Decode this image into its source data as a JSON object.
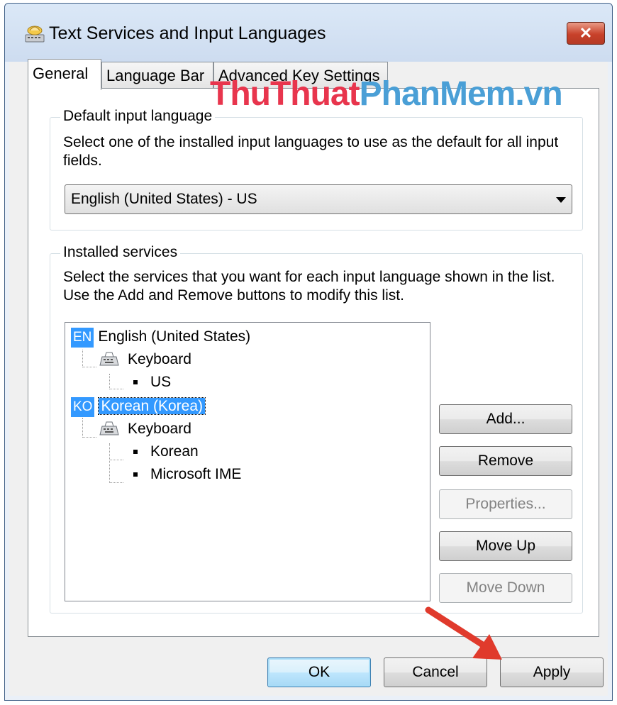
{
  "window": {
    "title": "Text Services and Input Languages",
    "close_glyph": "✕"
  },
  "tabs": [
    {
      "label": "General"
    },
    {
      "label": "Language Bar"
    },
    {
      "label": "Advanced Key Settings"
    }
  ],
  "watermark": {
    "part1": "ThuThuat",
    "part2": "PhanMem.vn"
  },
  "default_group": {
    "title": "Default input language",
    "description": "Select one of the installed input languages to use as the default for all input fields.",
    "selected_language": "English (United States) - US"
  },
  "services_group": {
    "title": "Installed services",
    "description_line1": "Select the services that you want for each input language shown in the list.",
    "description_line2": "Use the Add and Remove buttons to modify this list.",
    "tree": {
      "en": {
        "badge": "EN",
        "label": "English (United States)",
        "keyboard": "Keyboard",
        "layouts": [
          "US"
        ]
      },
      "ko": {
        "badge": "KO",
        "label": "Korean (Korea)",
        "keyboard": "Keyboard",
        "layouts": [
          "Korean",
          "Microsoft IME"
        ]
      }
    },
    "buttons": {
      "add": "Add...",
      "remove": "Remove",
      "properties": "Properties...",
      "move_up": "Move Up",
      "move_down": "Move Down"
    }
  },
  "footer": {
    "ok": "OK",
    "cancel": "Cancel",
    "apply": "Apply"
  },
  "colors": {
    "watermark_red": "#e8354d",
    "watermark_blue": "#4a9fd6",
    "selection": "#3399ff",
    "arrow": "#e03a2c"
  },
  "icons": [
    "text-services-icon",
    "close-icon",
    "dropdown-arrow-icon",
    "keyboard-icon",
    "red-arrow-pointer"
  ]
}
